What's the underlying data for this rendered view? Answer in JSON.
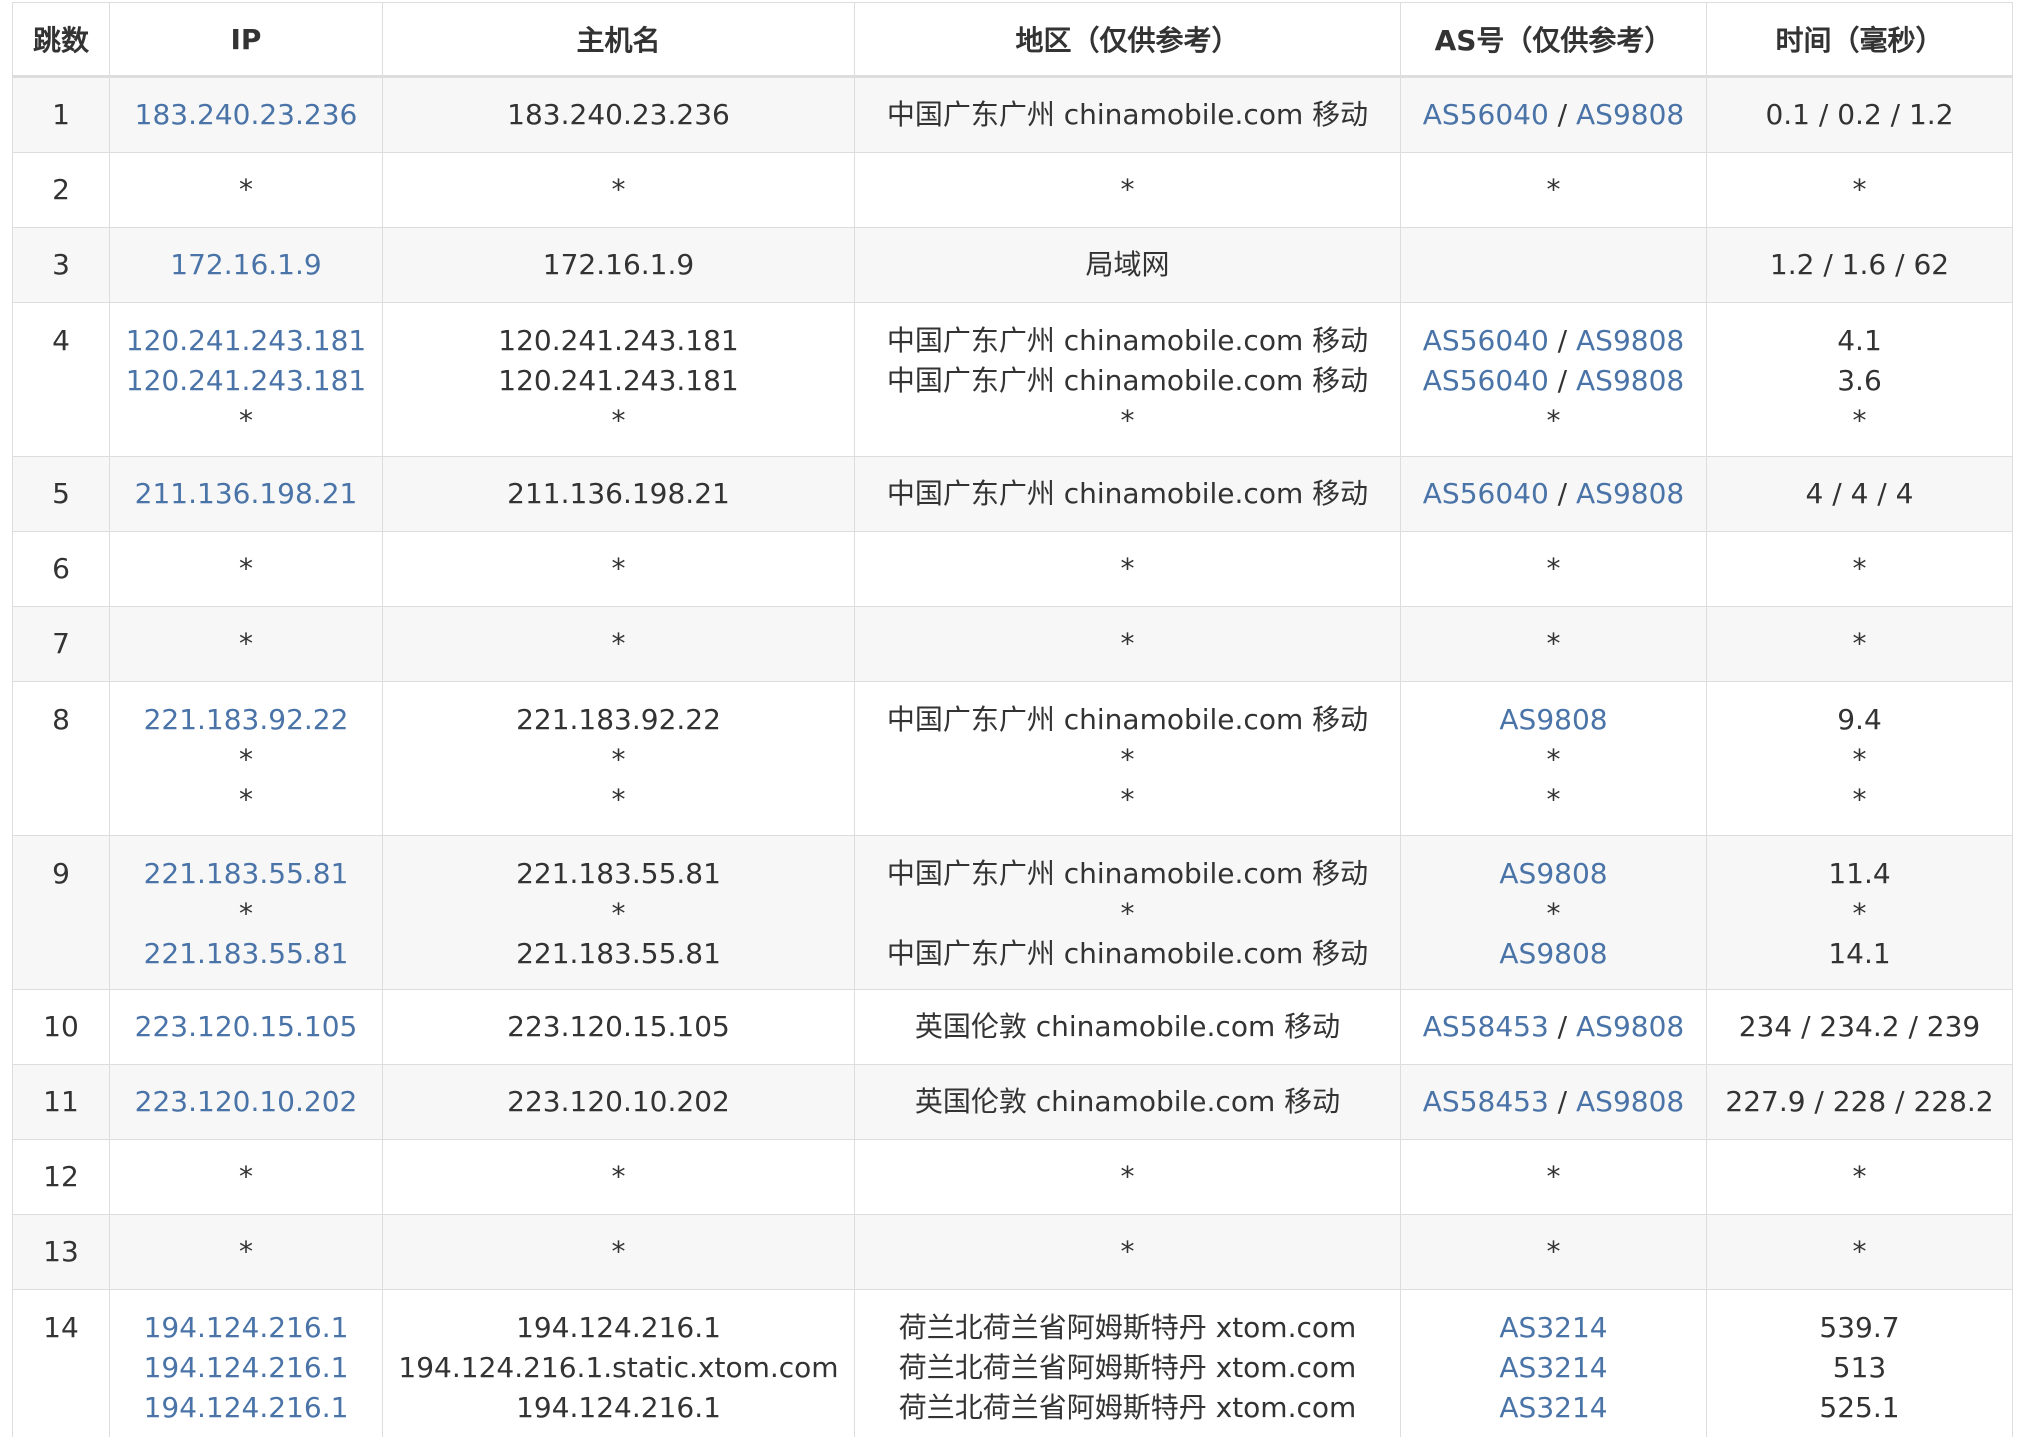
{
  "headers": [
    "跳数",
    "IP",
    "主机名",
    "地区（仅供参考）",
    "AS号（仅供参考）",
    "时间（毫秒）"
  ],
  "rows": [
    {
      "hop": "1",
      "lines": [
        {
          "ip": "183.240.23.236",
          "host": "183.240.23.236",
          "region": "中国广东广州 chinamobile.com 移动",
          "as": [
            "AS56040",
            "AS9808"
          ],
          "time": "0.1 / 0.2 / 1.2"
        }
      ]
    },
    {
      "hop": "2",
      "lines": [
        {
          "ip": "*",
          "host": "*",
          "region": "*",
          "as": [
            "*"
          ],
          "time": "*"
        }
      ]
    },
    {
      "hop": "3",
      "lines": [
        {
          "ip": "172.16.1.9",
          "host": "172.16.1.9",
          "region": "局域网",
          "as": [],
          "time": "1.2 / 1.6 / 62"
        }
      ]
    },
    {
      "hop": "4",
      "lines": [
        {
          "ip": "120.241.243.181",
          "host": "120.241.243.181",
          "region": "中国广东广州 chinamobile.com 移动",
          "as": [
            "AS56040",
            "AS9808"
          ],
          "time": "4.1"
        },
        {
          "ip": "120.241.243.181",
          "host": "120.241.243.181",
          "region": "中国广东广州 chinamobile.com 移动",
          "as": [
            "AS56040",
            "AS9808"
          ],
          "time": "3.6"
        },
        {
          "ip": "*",
          "host": "*",
          "region": "*",
          "as": [
            "*"
          ],
          "time": "*"
        }
      ]
    },
    {
      "hop": "5",
      "lines": [
        {
          "ip": "211.136.198.21",
          "host": "211.136.198.21",
          "region": "中国广东广州 chinamobile.com 移动",
          "as": [
            "AS56040",
            "AS9808"
          ],
          "time": "4 / 4 / 4"
        }
      ]
    },
    {
      "hop": "6",
      "lines": [
        {
          "ip": "*",
          "host": "*",
          "region": "*",
          "as": [
            "*"
          ],
          "time": "*"
        }
      ]
    },
    {
      "hop": "7",
      "lines": [
        {
          "ip": "*",
          "host": "*",
          "region": "*",
          "as": [
            "*"
          ],
          "time": "*"
        }
      ]
    },
    {
      "hop": "8",
      "lines": [
        {
          "ip": "221.183.92.22",
          "host": "221.183.92.22",
          "region": "中国广东广州 chinamobile.com 移动",
          "as": [
            "AS9808"
          ],
          "time": "9.4"
        },
        {
          "ip": "*",
          "host": "*",
          "region": "*",
          "as": [
            "*"
          ],
          "time": "*"
        },
        {
          "ip": "*",
          "host": "*",
          "region": "*",
          "as": [
            "*"
          ],
          "time": "*"
        }
      ]
    },
    {
      "hop": "9",
      "lines": [
        {
          "ip": "221.183.55.81",
          "host": "221.183.55.81",
          "region": "中国广东广州 chinamobile.com 移动",
          "as": [
            "AS9808"
          ],
          "time": "11.4"
        },
        {
          "ip": "*",
          "host": "*",
          "region": "*",
          "as": [
            "*"
          ],
          "time": "*"
        },
        {
          "ip": "221.183.55.81",
          "host": "221.183.55.81",
          "region": "中国广东广州 chinamobile.com 移动",
          "as": [
            "AS9808"
          ],
          "time": "14.1"
        }
      ]
    },
    {
      "hop": "10",
      "lines": [
        {
          "ip": "223.120.15.105",
          "host": "223.120.15.105",
          "region": "英国伦敦 chinamobile.com 移动",
          "as": [
            "AS58453",
            "AS9808"
          ],
          "time": "234 / 234.2 / 239"
        }
      ]
    },
    {
      "hop": "11",
      "lines": [
        {
          "ip": "223.120.10.202",
          "host": "223.120.10.202",
          "region": "英国伦敦 chinamobile.com 移动",
          "as": [
            "AS58453",
            "AS9808"
          ],
          "time": "227.9 / 228 / 228.2"
        }
      ]
    },
    {
      "hop": "12",
      "lines": [
        {
          "ip": "*",
          "host": "*",
          "region": "*",
          "as": [
            "*"
          ],
          "time": "*"
        }
      ]
    },
    {
      "hop": "13",
      "lines": [
        {
          "ip": "*",
          "host": "*",
          "region": "*",
          "as": [
            "*"
          ],
          "time": "*"
        }
      ]
    },
    {
      "hop": "14",
      "lines": [
        {
          "ip": "194.124.216.1",
          "host": "194.124.216.1",
          "region": "荷兰北荷兰省阿姆斯特丹 xtom.com",
          "as": [
            "AS3214"
          ],
          "time": "539.7"
        },
        {
          "ip": "194.124.216.1",
          "host": "194.124.216.1.static.xtom.com",
          "region": "荷兰北荷兰省阿姆斯特丹 xtom.com",
          "as": [
            "AS3214"
          ],
          "time": "513"
        },
        {
          "ip": "194.124.216.1",
          "host": "194.124.216.1",
          "region": "荷兰北荷兰省阿姆斯特丹 xtom.com",
          "as": [
            "AS3214"
          ],
          "time": "525.1"
        }
      ]
    }
  ],
  "colors": {
    "link": "#4a74a8",
    "text": "#333333",
    "border": "#dddddd",
    "stripe": "#f7f7f7"
  }
}
